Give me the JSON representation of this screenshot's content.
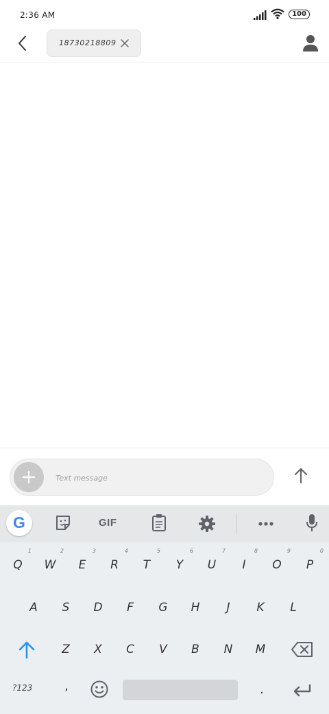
{
  "status_bar": {
    "time": "2:36 AM",
    "battery": "100",
    "icons": [
      "signal-icon",
      "wifi-icon",
      "battery-icon"
    ]
  },
  "header": {
    "back_icon": "chevron-left-icon",
    "recipient_chip": "18730218809",
    "chip_close_icon": "close-icon",
    "contact_icon": "person-icon"
  },
  "compose": {
    "placeholder": "Text message",
    "attach_icon": "plus-icon",
    "send_icon": "arrow-up-icon"
  },
  "keyboard": {
    "toolbar": {
      "google_label": "G",
      "gif_label": "GIF",
      "icons": [
        "google-icon",
        "sticker-icon",
        "gif-icon",
        "clipboard-icon",
        "gear-icon",
        "more-icon",
        "mic-icon"
      ]
    },
    "row1": [
      {
        "key": "Q",
        "hint": "1"
      },
      {
        "key": "W",
        "hint": "2"
      },
      {
        "key": "E",
        "hint": "3"
      },
      {
        "key": "R",
        "hint": "4"
      },
      {
        "key": "T",
        "hint": "5"
      },
      {
        "key": "Y",
        "hint": "6"
      },
      {
        "key": "U",
        "hint": "7"
      },
      {
        "key": "I",
        "hint": "8"
      },
      {
        "key": "O",
        "hint": "9"
      },
      {
        "key": "P",
        "hint": "0"
      }
    ],
    "row2": [
      "A",
      "S",
      "D",
      "F",
      "G",
      "H",
      "J",
      "K",
      "L"
    ],
    "row3": [
      "Z",
      "X",
      "C",
      "V",
      "B",
      "N",
      "M"
    ],
    "symbols_label": "?123",
    "comma": ",",
    "period": ".",
    "accent_color": "#2196F3"
  }
}
